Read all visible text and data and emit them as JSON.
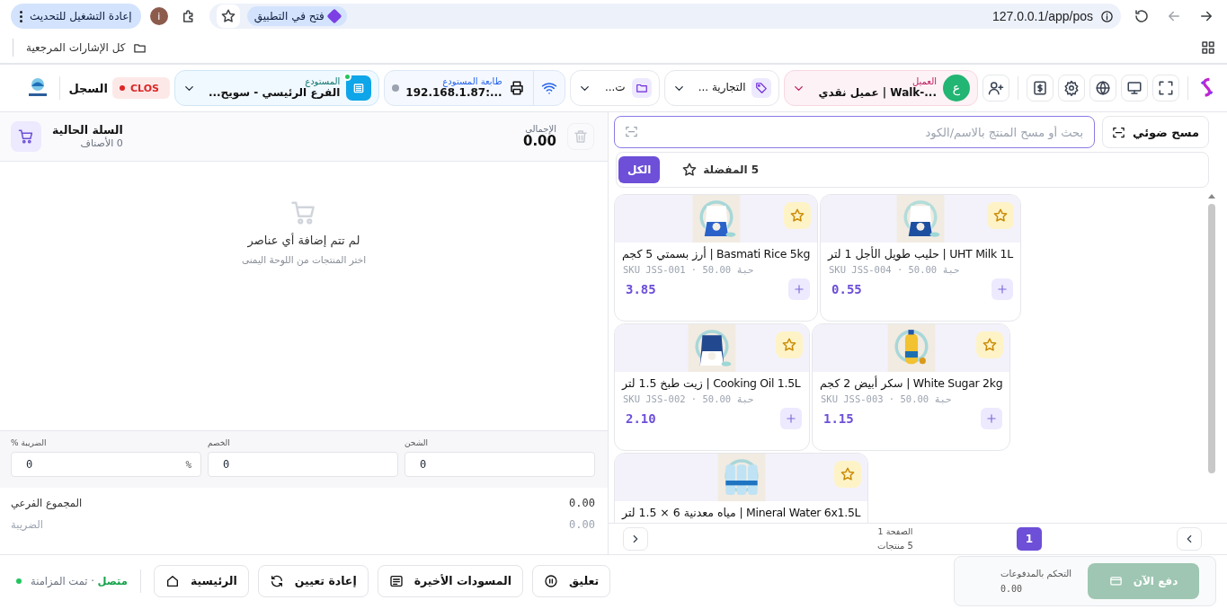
{
  "browser": {
    "address": "127.0.0.1/app/pos",
    "open_in_app": "فتح في التطبيق",
    "profile_initial": "i",
    "restart_button": "إعادة التشغيل للتحديث",
    "bookmarks_folder": "كل الإشارات المرجعية"
  },
  "header": {
    "customer": {
      "label": "العميل",
      "initial": "ع",
      "value": "عميل نقدي | Walk-..."
    },
    "brand_filter": {
      "value": "التجارية ..."
    },
    "category_filter": {
      "value": "ت..."
    },
    "printer": {
      "label": "طابعة المستودع",
      "value": "192.168.1.87:...",
      "connected": false
    },
    "warehouse": {
      "label": "المستودع",
      "value": "الفرع الرئيسي - سويح...",
      "online": true
    },
    "register_status": "CLOS",
    "register_label": "السجل"
  },
  "search": {
    "scan_button": "مسح ضوئي",
    "placeholder": "بحث أو مسح المنتج بالاسم/الكود"
  },
  "filters": [
    {
      "kind": "favorites",
      "label": "5 المفضلة",
      "selected": false
    },
    {
      "kind": "all",
      "label": "الكل",
      "selected": true
    }
  ],
  "products": [
    {
      "name": "UHT Milk 1L | حليب طويل الأجل 1 لتر",
      "meta": "SKU JSS-004 · 50.00 حبة",
      "price": "0.55",
      "favorite": false
    },
    {
      "name": "Basmati Rice 5kg | أرز بسمتي 5 كجم",
      "meta": "SKU JSS-001 · 50.00 حبة",
      "price": "3.85",
      "favorite": false
    },
    {
      "name": "White Sugar 2kg | سكر أبيض 2 كجم",
      "meta": "SKU JSS-003 · 50.00 حبة",
      "price": "1.15",
      "favorite": false
    },
    {
      "name": "Cooking Oil 1.5L | زيت طبخ 1.5 لتر",
      "meta": "SKU JSS-002 · 50.00 حبة",
      "price": "2.10",
      "favorite": false
    },
    {
      "name": "Mineral Water 6x1.5L | مياه معدنية 6 × 1.5 لتر",
      "favorite": false
    }
  ],
  "pagination": {
    "pages": [
      {
        "label": "1",
        "selected": true
      }
    ],
    "page_text": "الصفحة 1",
    "count_text": "5 منتجات"
  },
  "cart": {
    "title": "السلة الحالية",
    "items_text": "0 الأصناف",
    "total_label": "الإجمالي",
    "total": "0.00",
    "empty_title": "لم تتم إضافة أي عناصر",
    "empty_hint": "اختر المنتجات من اللوحة اليمنى",
    "fields": [
      {
        "label": "الشحن",
        "value": "0"
      },
      {
        "label": "الخصم",
        "value": "0"
      },
      {
        "label": "الضريبة %",
        "value": "0",
        "suffix": "%"
      }
    ],
    "summary": [
      {
        "label": "المجموع الفرعي",
        "value": "0.00",
        "muted": false
      },
      {
        "label": "الضريبة",
        "value": "0.00",
        "muted": true
      }
    ]
  },
  "payment": {
    "pay_button": "دفع الآن",
    "pay_disabled": true,
    "label": "التحكم بالمدفوعات",
    "amount": "0.00"
  },
  "actions": [
    "تعليق",
    "المسودات الأخيرة",
    "إعادة تعيين",
    "الرئيسية"
  ],
  "status": {
    "text": "**متصل** · تمت المزامنة",
    "online": true
  }
}
